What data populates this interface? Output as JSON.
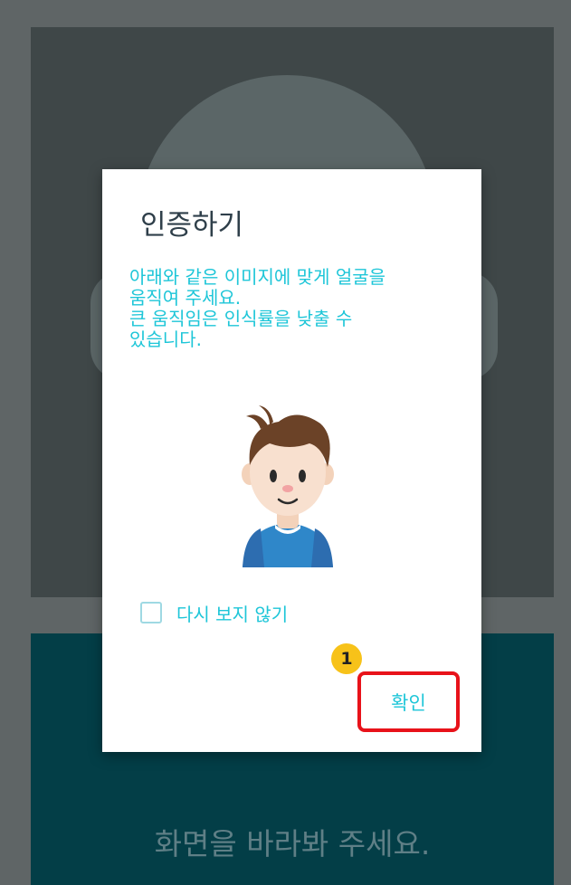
{
  "background": {
    "instruction_text": "화면을 바라봐 주세요."
  },
  "dialog": {
    "title": "인증하기",
    "message_lines": [
      "아래와 같은 이미지에 맞게 얼굴을",
      "움직여 주세요.",
      "큰 움직임은 인식률을 낮출 수",
      "있습니다."
    ],
    "checkbox_label": "다시 보지 않기",
    "checkbox_checked": false,
    "confirm_label": "확인",
    "avatar_icon": "boy-face-avatar"
  },
  "annotation": {
    "step_number": "1",
    "highlight_color": "#e8121a",
    "badge_color": "#f7c219"
  },
  "colors": {
    "accent": "#1ec6d8",
    "bottom_panel": "#033e47"
  }
}
